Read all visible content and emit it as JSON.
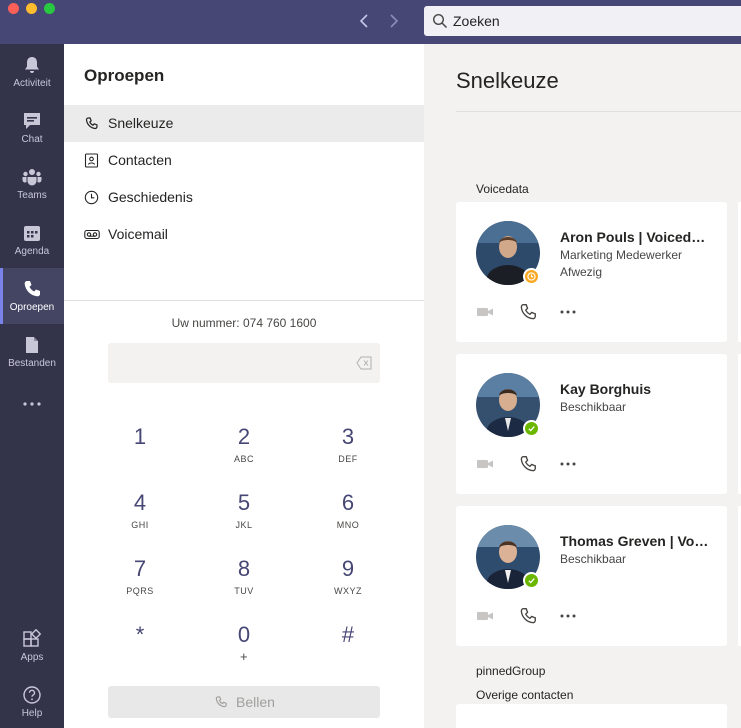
{
  "search": {
    "placeholder": "Zoeken"
  },
  "rail": {
    "items": [
      {
        "label": "Activiteit",
        "icon": "bell-icon"
      },
      {
        "label": "Chat",
        "icon": "chat-icon"
      },
      {
        "label": "Teams",
        "icon": "teams-icon"
      },
      {
        "label": "Agenda",
        "icon": "calendar-icon"
      },
      {
        "label": "Oproepen",
        "icon": "phone-icon",
        "active": true
      },
      {
        "label": "Bestanden",
        "icon": "file-icon"
      },
      {
        "label": "",
        "icon": "more-icon"
      }
    ],
    "bottom": [
      {
        "label": "Apps",
        "icon": "apps-icon"
      },
      {
        "label": "Help",
        "icon": "help-icon"
      }
    ]
  },
  "calls": {
    "title": "Oproepen",
    "nav": [
      {
        "label": "Snelkeuze",
        "icon": "phone-icon",
        "active": true
      },
      {
        "label": "Contacten",
        "icon": "contacts-icon"
      },
      {
        "label": "Geschiedenis",
        "icon": "history-icon"
      },
      {
        "label": "Voicemail",
        "icon": "voicemail-icon"
      }
    ],
    "my_number": "Uw nummer: 074 760 1600",
    "keypad": [
      {
        "digit": "1",
        "sub": ""
      },
      {
        "digit": "2",
        "sub": "ABC"
      },
      {
        "digit": "3",
        "sub": "DEF"
      },
      {
        "digit": "4",
        "sub": "GHI"
      },
      {
        "digit": "5",
        "sub": "JKL"
      },
      {
        "digit": "6",
        "sub": "MNO"
      },
      {
        "digit": "7",
        "sub": "PQRS"
      },
      {
        "digit": "8",
        "sub": "TUV"
      },
      {
        "digit": "9",
        "sub": "WXYZ"
      },
      {
        "digit": "*",
        "sub": ""
      },
      {
        "digit": "0",
        "sub": "+"
      },
      {
        "digit": "#",
        "sub": ""
      }
    ],
    "call_button": "Bellen"
  },
  "speed_dial": {
    "title": "Snelkeuze",
    "group1": "Voicedata",
    "contacts": [
      {
        "name": "Aron Pouls | Voicedata",
        "title": "Marketing Medewerker",
        "status": "Afwezig",
        "presence": "away"
      },
      {
        "name": "Kay Borghuis",
        "title": "",
        "status": "Beschikbaar",
        "presence": "available"
      },
      {
        "name": "Thomas Greven | Voicedata",
        "title": "",
        "status": "Beschikbaar",
        "presence": "available"
      }
    ],
    "group2": "pinnedGroup",
    "group3": "Overige contacten"
  },
  "colors": {
    "titlebar": "#464775",
    "rail": "#33344a",
    "accent": "#7b83eb",
    "away": "#f8a820",
    "available": "#6bb700"
  }
}
